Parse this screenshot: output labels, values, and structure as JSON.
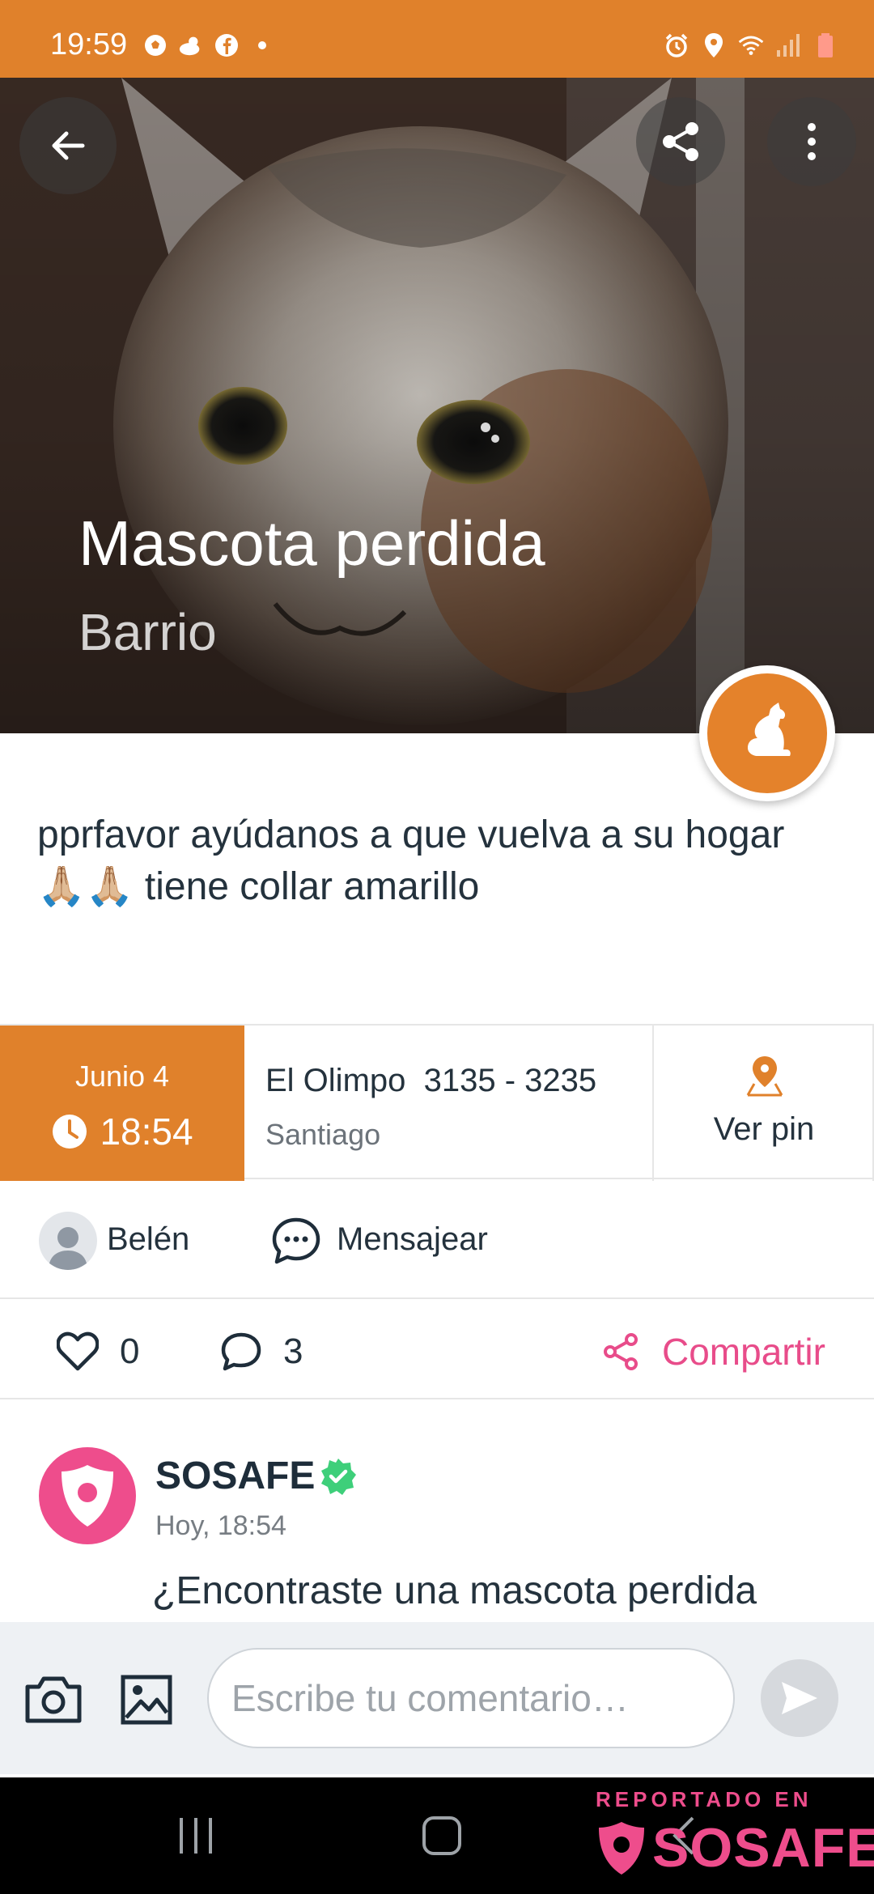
{
  "status_bar": {
    "time": "19:59"
  },
  "header": {
    "title": "Mascota perdida",
    "subtitle": "Barrio"
  },
  "post": {
    "description": "pprfavor ayúdanos a que vuelva a su hogar 🙏🏼🙏🏼 tiene collar amarillo"
  },
  "info": {
    "date": "Junio 4",
    "time": "18:54",
    "street": "El Olimpo  3135 - 3235",
    "city": "Santiago",
    "pin_label": "Ver pin"
  },
  "author": {
    "name": "Belén",
    "message_label": "Mensajear"
  },
  "actions": {
    "likes": "0",
    "comments": "3",
    "share_label": "Compartir"
  },
  "comment_preview": {
    "author": "SOSAFE",
    "time": "Hoy, 18:54",
    "text": "¿Encontraste una mascota perdida"
  },
  "composer": {
    "placeholder": "Escribe tu comentario…"
  },
  "watermark": {
    "top_text": "REPORTADO EN",
    "brand": "SOSAFE"
  },
  "colors": {
    "accent_orange": "#e0812b",
    "brand_pink": "#ee4d8c",
    "verified_green": "#3ecf7a"
  },
  "icons": {
    "status_left": [
      "soccer-ball-icon",
      "weather-icon",
      "facebook-icon",
      "dot-icon"
    ],
    "status_right": [
      "alarm-icon",
      "location-icon",
      "wifi-icon",
      "signal-icon",
      "battery-icon"
    ],
    "category": "dog-icon"
  }
}
